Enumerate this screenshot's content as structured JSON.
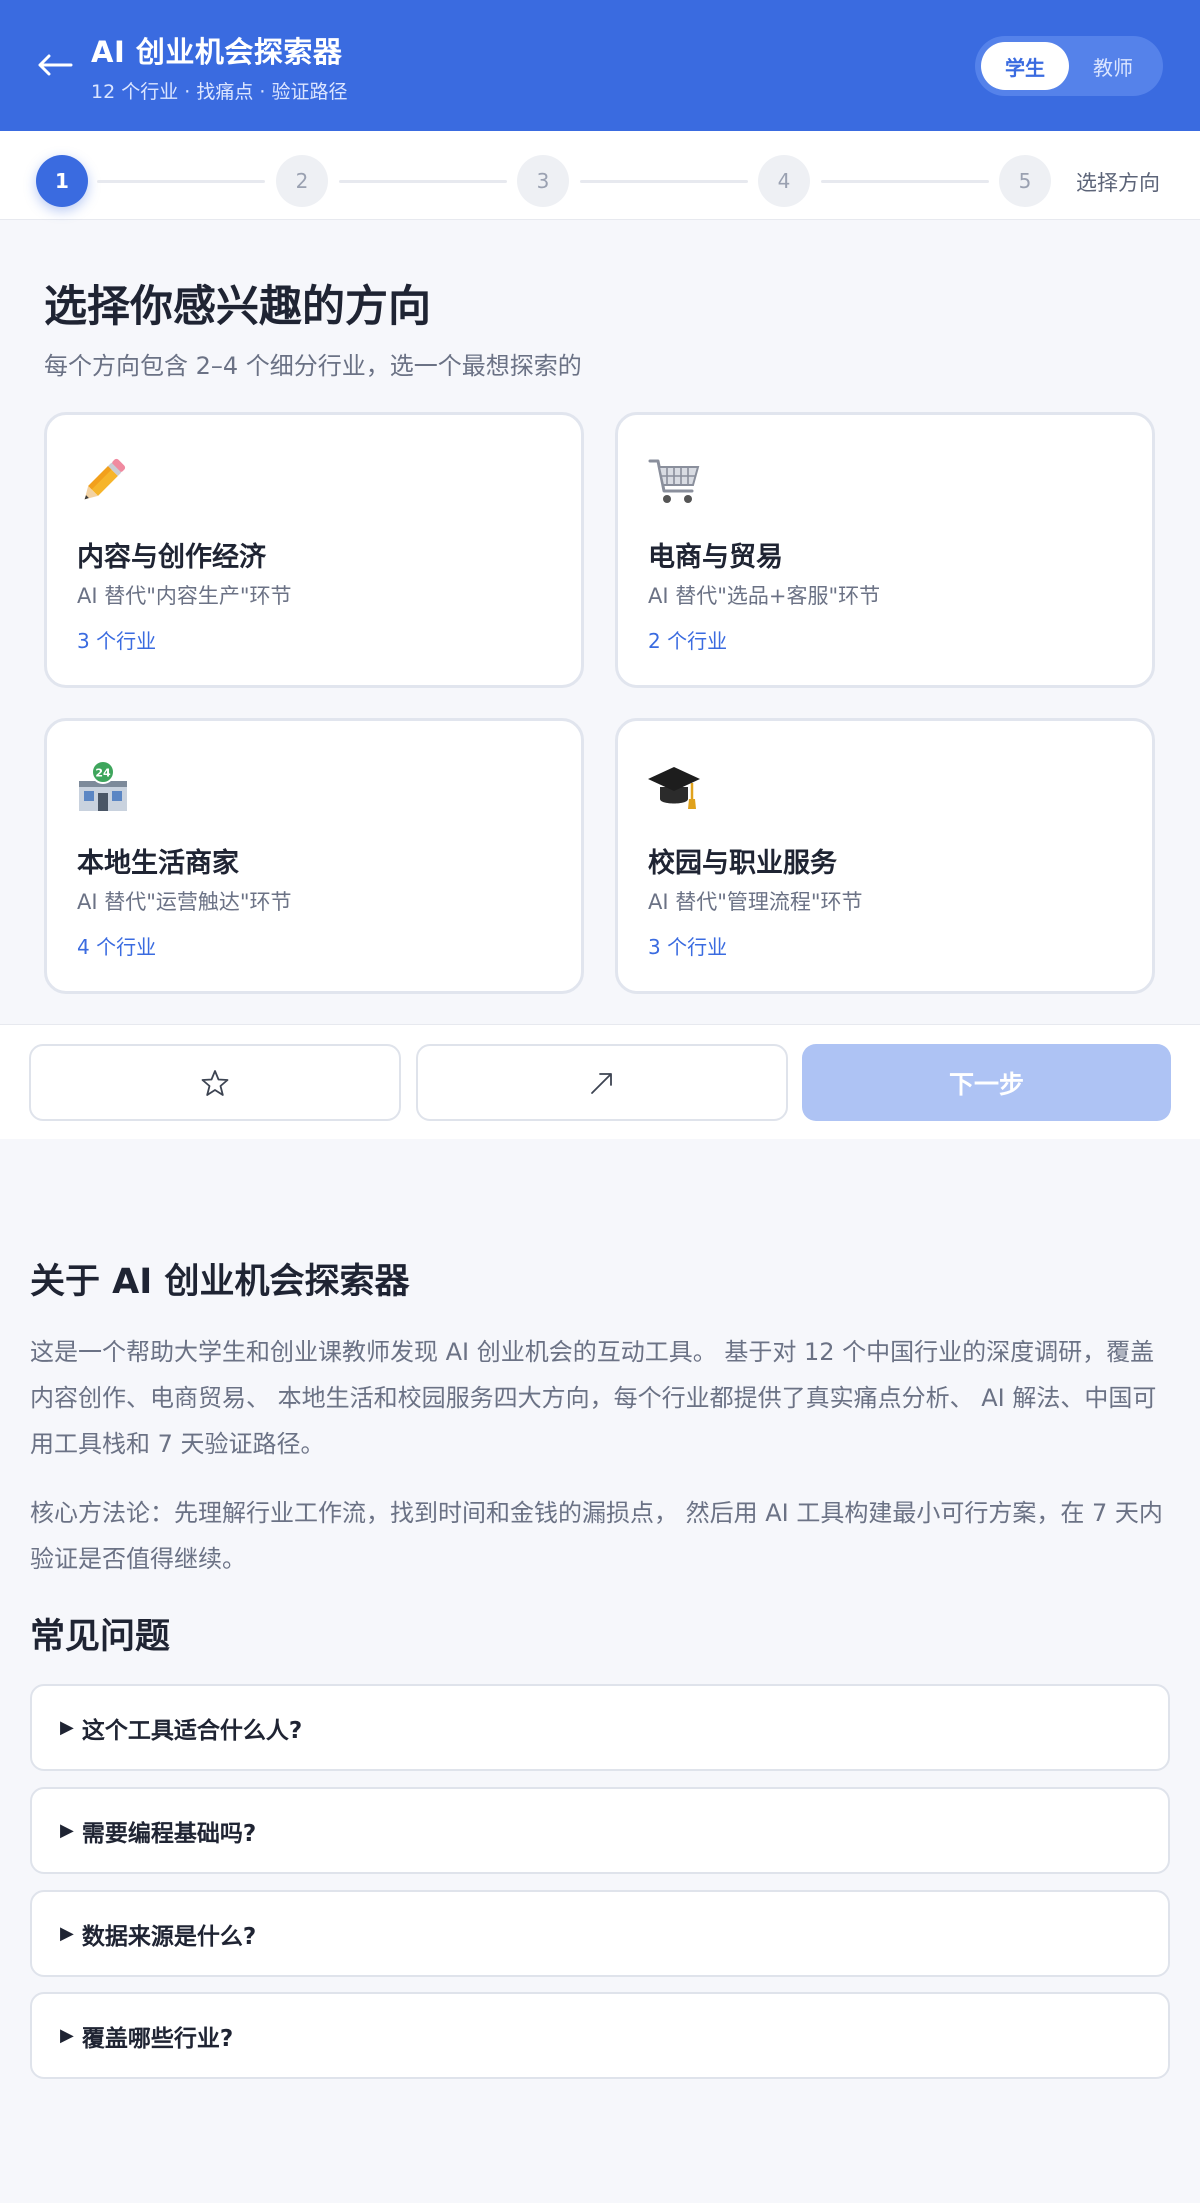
{
  "header": {
    "back_icon": "arrow-left-icon",
    "title": "AI 创业机会探索器",
    "subtitle": "12 个行业 · 找痛点 · 验证路径",
    "roles": [
      "学生",
      "教师"
    ],
    "active_role": "学生"
  },
  "stepper": {
    "steps": [
      "1",
      "2",
      "3",
      "4",
      "5"
    ],
    "current": 1,
    "current_label": "选择方向"
  },
  "main": {
    "title": "选择你感兴趣的方向",
    "subtitle": "每个方向包含 2–4 个细分行业，选一个最想探索的",
    "cards": [
      {
        "icon": "pencil-icon",
        "title": "内容与创作经济",
        "desc": "AI 替代\"内容生产\"环节",
        "count": "3 个行业"
      },
      {
        "icon": "shopping-cart-icon",
        "title": "电商与贸易",
        "desc": "AI 替代\"选品+客服\"环节",
        "count": "2 个行业"
      },
      {
        "icon": "convenience-store-icon",
        "title": "本地生活商家",
        "desc": "AI 替代\"运营触达\"环节",
        "count": "4 个行业"
      },
      {
        "icon": "graduation-cap-icon",
        "title": "校园与职业服务",
        "desc": "AI 替代\"管理流程\"环节",
        "count": "3 个行业"
      }
    ]
  },
  "actions": {
    "favorite_icon": "star-icon",
    "share_icon": "share-arrow-icon",
    "next_label": "下一步"
  },
  "about": {
    "title": "关于 AI 创业机会探索器",
    "para1": "这是一个帮助大学生和创业课教师发现 AI 创业机会的互动工具。 基于对 12 个中国行业的深度调研，覆盖内容创作、电商贸易、 本地生活和校园服务四大方向，每个行业都提供了真实痛点分析、 AI 解法、中国可用工具栈和 7 天验证路径。",
    "para2": "核心方法论：先理解行业工作流，找到时间和金钱的漏损点， 然后用 AI 工具构建最小可行方案，在 7 天内验证是否值得继续。"
  },
  "faq": {
    "title": "常见问题",
    "items": [
      "这个工具适合什么人?",
      "需要编程基础吗?",
      "数据来源是什么?",
      "覆盖哪些行业?"
    ]
  },
  "colors": {
    "primary": "#3a6be0",
    "primary_disabled": "#aec3f4",
    "background": "#f6f7fb"
  }
}
